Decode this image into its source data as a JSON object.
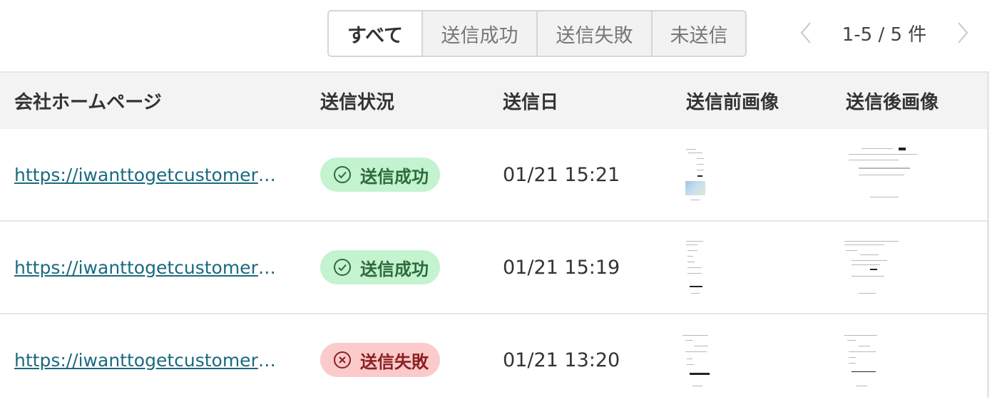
{
  "filters": {
    "tabs": [
      {
        "label": "すべて",
        "active": true
      },
      {
        "label": "送信成功",
        "active": false
      },
      {
        "label": "送信失敗",
        "active": false
      },
      {
        "label": "未送信",
        "active": false
      }
    ]
  },
  "pagination": {
    "range_text": "1-5 / 5 件",
    "prev_icon": "chevron-left-icon",
    "next_icon": "chevron-right-icon"
  },
  "table": {
    "columns": [
      "会社ホームページ",
      "送信状況",
      "送信日",
      "送信前画像",
      "送信後画像"
    ],
    "rows": [
      {
        "url": "https://iwanttogetcustomers.wordpress.com/",
        "status": "送信成功",
        "status_type": "success",
        "date": "01/21 15:21"
      },
      {
        "url": "https://iwanttogetcustomers.wordpress.com/",
        "status": "送信成功",
        "status_type": "success",
        "date": "01/21 15:19"
      },
      {
        "url": "https://iwanttogetcustomers.wordpress.com/",
        "status": "送信失敗",
        "status_type": "fail",
        "date": "01/21 13:20"
      }
    ]
  },
  "colors": {
    "success_bg": "#c3f3cf",
    "success_text": "#2e6b3b",
    "fail_bg": "#fbcaca",
    "fail_text": "#8a2121",
    "link": "#1a6a80"
  }
}
